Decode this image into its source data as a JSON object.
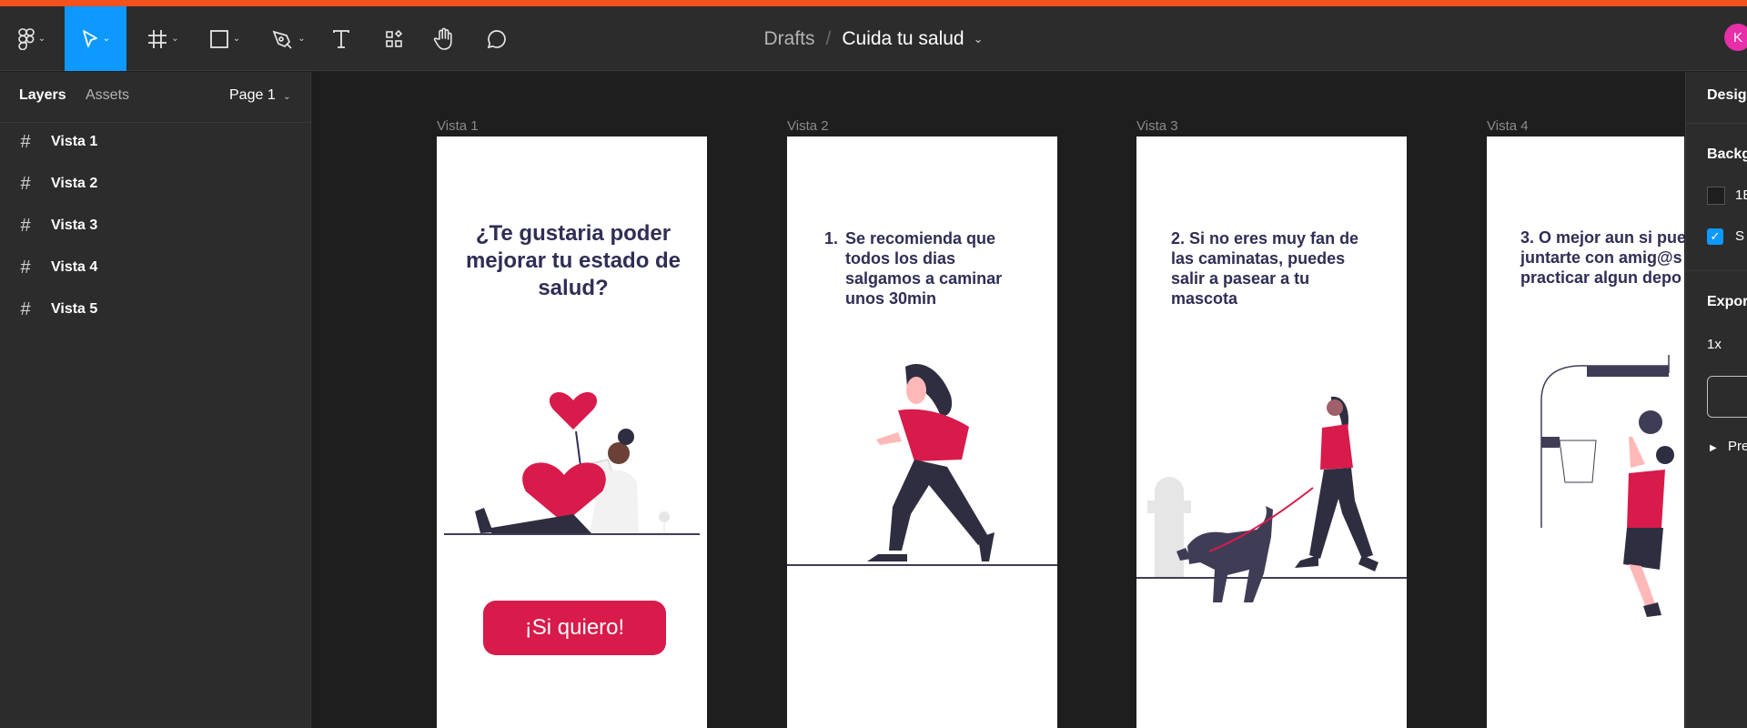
{
  "toolbar": {
    "breadcrumb_parent": "Drafts",
    "breadcrumb_separator": "/",
    "file_name": "Cuida tu salud",
    "avatar_initial": "K",
    "accent_color": "#0d99ff",
    "tools": [
      "figma-menu-icon",
      "move-tool-icon",
      "frame-tool-icon",
      "shape-tool-icon",
      "pen-tool-icon",
      "text-tool-icon",
      "resources-icon",
      "hand-tool-icon",
      "comment-icon"
    ]
  },
  "left_panel": {
    "tab_layers": "Layers",
    "tab_assets": "Assets",
    "page": "Page 1",
    "layers": [
      "Vista 1",
      "Vista 2",
      "Vista 3",
      "Vista 4",
      "Vista 5"
    ]
  },
  "right_panel": {
    "title": "Desig",
    "background_label": "Backg",
    "bg_value": "1E",
    "show_label": "S",
    "export_label": "Expor",
    "export_scale": "1x",
    "preview_label": "Pre"
  },
  "frames": [
    {
      "label": "Vista 1",
      "headline": "¿Te gustaria poder mejorar tu estado de salud?",
      "button": "¡Si quiero!"
    },
    {
      "label": "Vista 2",
      "number": "1.",
      "headline": "Se recomienda que todos los dias salgamos a caminar unos 30min"
    },
    {
      "label": "Vista 3",
      "headline": "2. Si no eres muy fan de las caminatas, puedes salir a pasear a tu mascota"
    },
    {
      "label": "Vista 4",
      "headline": "3. O mejor aun si pue juntarte con amig@s practicar algun depo"
    }
  ],
  "colors": {
    "brand_red": "#d81b4a",
    "navy": "#2f2e55"
  }
}
